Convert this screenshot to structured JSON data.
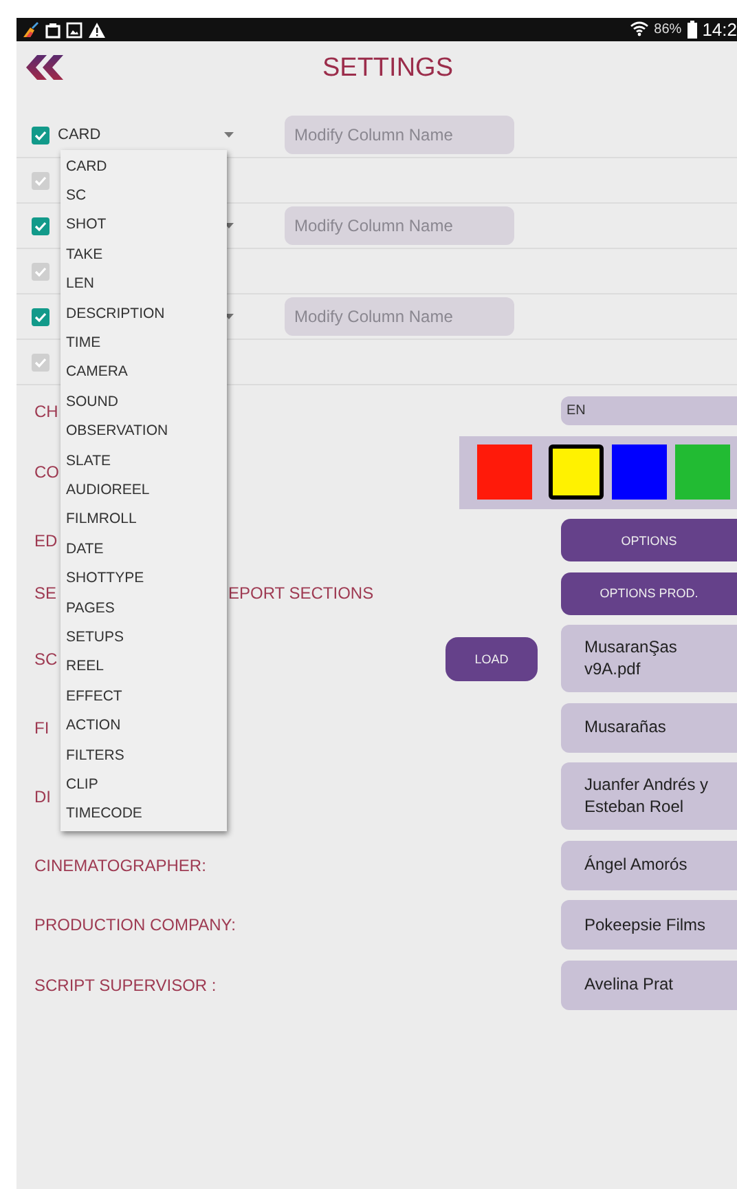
{
  "status_bar": {
    "battery": "86%",
    "time": "14:2"
  },
  "header": {
    "title": "SETTINGS"
  },
  "columns": [
    {
      "checked": true,
      "value": "CARD",
      "placeholder": "Modify Column Name",
      "sub_checked": true,
      "sub_disabled": true
    },
    {
      "checked": true,
      "placeholder": "Modify Column Name",
      "sub_checked": true,
      "sub_disabled": true
    },
    {
      "checked": true,
      "placeholder": "Modify Column Name",
      "sub_checked": true,
      "sub_disabled": true
    }
  ],
  "dropdown": {
    "items": [
      "CARD",
      "SC",
      "SHOT",
      "TAKE",
      "LEN",
      "DESCRIPTION",
      "TIME",
      "CAMERA",
      "SOUND",
      "OBSERVATION",
      "SLATE",
      "AUDIOREEL",
      "FILMROLL",
      "DATE",
      "SHOTTYPE",
      "PAGES",
      "SETUPS",
      "REEL",
      "EFFECT",
      "ACTION",
      "FILTERS",
      "CLIP",
      "TIMECODE"
    ]
  },
  "settings": [
    {
      "kind": "field",
      "label": "CH",
      "value": "EN"
    },
    {
      "kind": "palette",
      "label": "CO",
      "swatches": [
        {
          "color": "#ff1a0a",
          "selected": false
        },
        {
          "color": "#fff200",
          "selected": true
        },
        {
          "color": "#0000ff",
          "selected": false
        },
        {
          "color": "#22bb33",
          "selected": false
        }
      ]
    },
    {
      "kind": "button",
      "label": "ED",
      "button": "OPTIONS"
    },
    {
      "kind": "button",
      "label": "SE",
      "label_tail": "EPORT SECTIONS",
      "button": "OPTIONS PROD."
    },
    {
      "kind": "file",
      "label": "SC",
      "button": "LOAD",
      "value": "MusaranŞas v9A.pdf"
    },
    {
      "kind": "text",
      "label": "FI",
      "value": "Musarañas"
    },
    {
      "kind": "text",
      "label": "DI",
      "value": "Juanfer Andrés y Esteban Roel"
    },
    {
      "kind": "text",
      "label": "CINEMATOGRAPHER:",
      "value": "Ángel Amorós"
    },
    {
      "kind": "text",
      "label": "PRODUCTION COMPANY:",
      "value": "Pokeepsie Films"
    },
    {
      "kind": "text",
      "label": "SCRIPT SUPERVISOR :",
      "value": "Avelina Prat"
    }
  ]
}
